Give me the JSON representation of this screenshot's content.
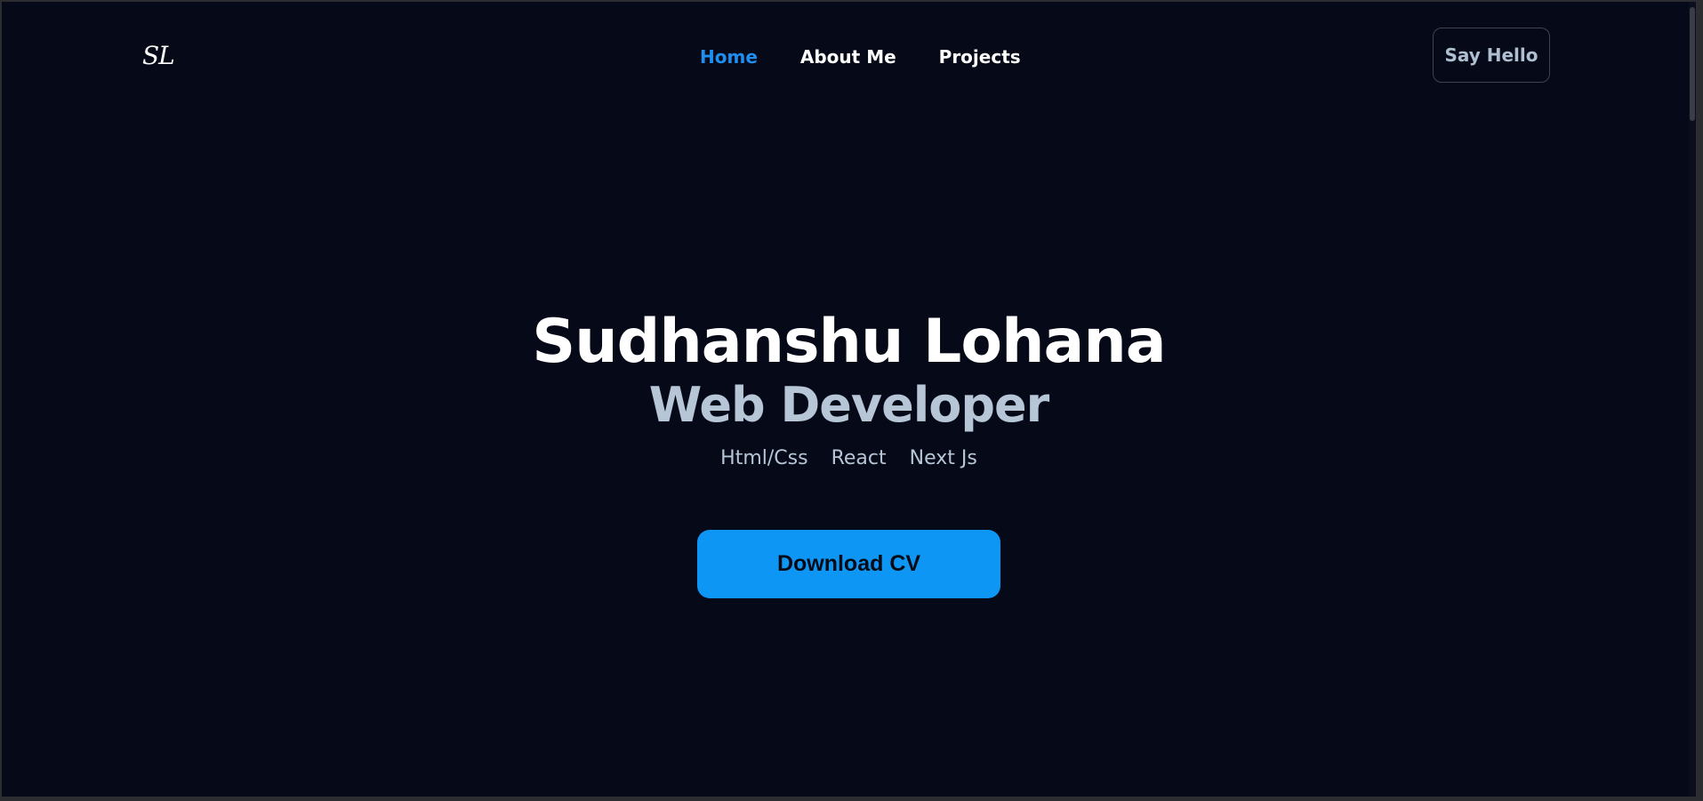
{
  "header": {
    "logo_text": "SL",
    "nav": [
      {
        "label": "Home",
        "active": true
      },
      {
        "label": "About Me",
        "active": false
      },
      {
        "label": "Projects",
        "active": false
      }
    ],
    "cta_label": "Say Hello"
  },
  "hero": {
    "name": "Sudhanshu Lohana",
    "role": "Web Developer",
    "skills": [
      "Html/Css",
      "React",
      "Next Js"
    ],
    "button_label": "Download CV"
  },
  "colors": {
    "background": "#060a18",
    "accent": "#1f8ef1",
    "button": "#0e96f4",
    "muted_text": "#b6c6d6"
  }
}
